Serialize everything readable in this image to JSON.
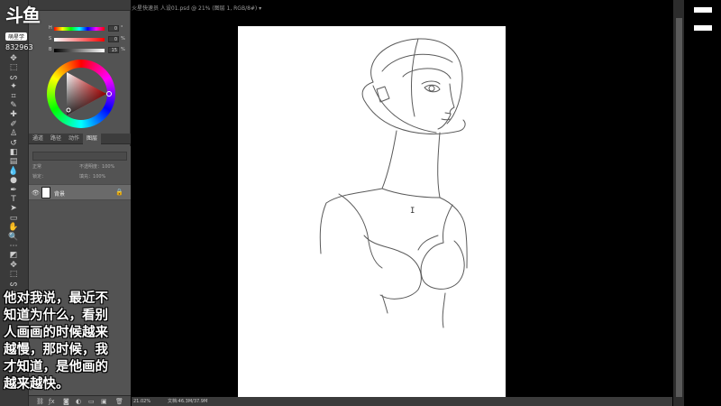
{
  "overlay": {
    "platform_logo": "斗鱼",
    "platform_tag": "萌星学",
    "room_id": "832963"
  },
  "document": {
    "tab_title": "火星快速员 人设01.psd @ 21% (图层 1, RGB/8#) ▾"
  },
  "color_panel": {
    "sliders": [
      {
        "label": "H",
        "value": "0",
        "unit": "°",
        "gradient": "linear-gradient(to right, #f00, #ff0, #0f0, #0ff, #00f, #f0f, #f00)"
      },
      {
        "label": "S",
        "value": "0",
        "unit": "%",
        "gradient": "linear-gradient(to right, #fff, #f00)"
      },
      {
        "label": "B",
        "value": "15",
        "unit": "%",
        "gradient": "linear-gradient(to right, #000, #fff)"
      }
    ]
  },
  "layers_panel": {
    "tabs": [
      "通道",
      "路径",
      "动作",
      "图层"
    ],
    "active_tab": "图层",
    "blend_mode": "正常",
    "opacity_label": "不透明度：",
    "opacity_value": "100%",
    "lock_label": "锁定：",
    "fill_label": "填充：",
    "fill_value": "100%",
    "layer_name": "背景"
  },
  "status": {
    "zoom": "21.02%",
    "doc_size": "文档:46.3M/37.9M"
  },
  "subtitle": {
    "lines": [
      "他对我说，最近不",
      "知道为什么，看别",
      "人画画的时候越来",
      "越慢，那时候，我",
      "才知道，是他画的",
      "越来越快。"
    ]
  },
  "colors": {
    "canvas": "#000000",
    "artboard": "#ffffff",
    "panel_bg": "#535353",
    "toolbar_bg": "#3a3a3a",
    "sketch_line": "#555555"
  }
}
